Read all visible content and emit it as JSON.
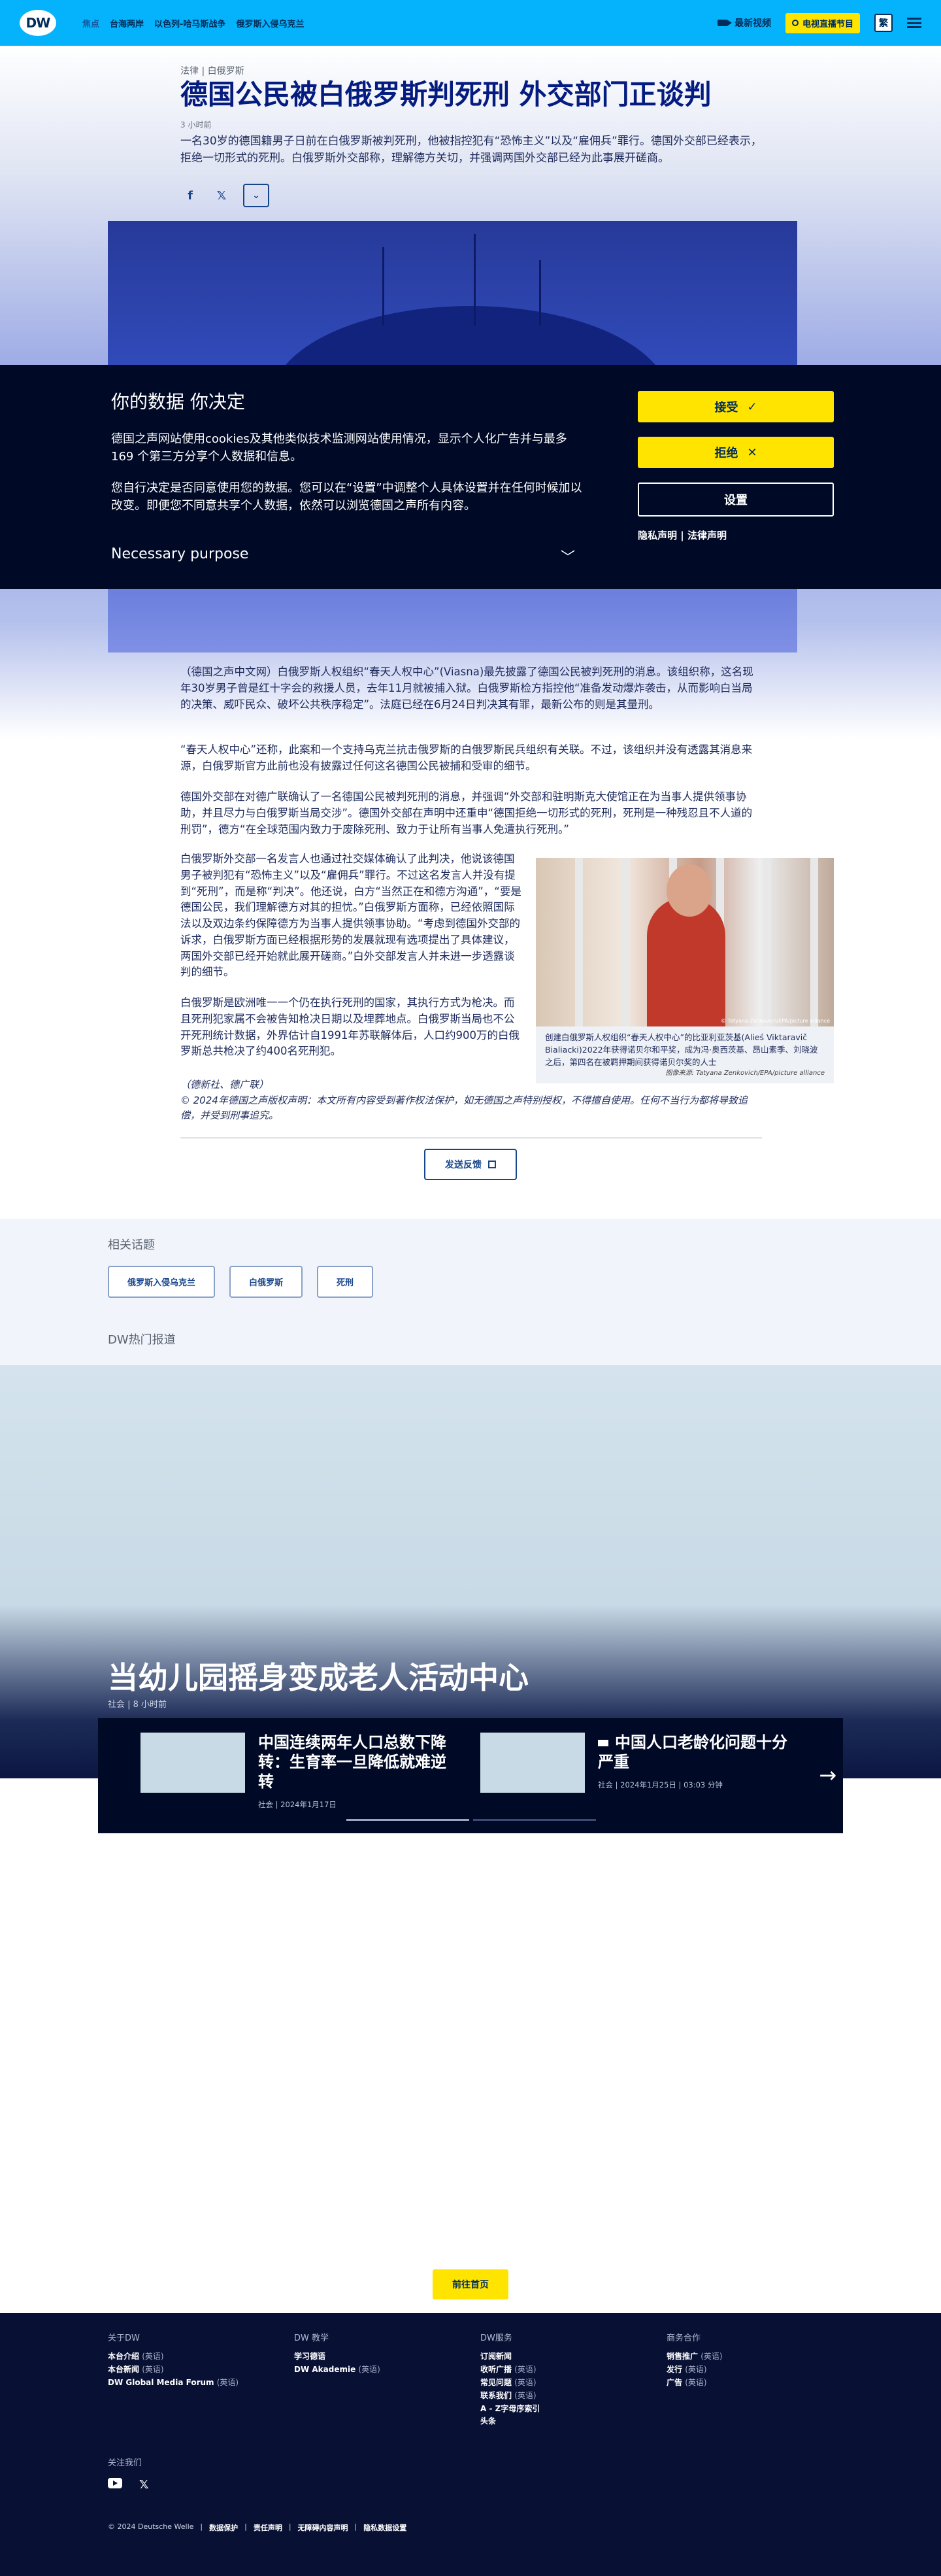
{
  "header": {
    "logo": "DW",
    "nav": [
      "焦点",
      "台海两岸",
      "以色列-哈马斯战争",
      "俄罗斯入侵乌克兰"
    ],
    "video_label": "最新视频",
    "live_label": "电视直播节目",
    "lang_label": "繁"
  },
  "article": {
    "breadcrumb": "法律 | 白俄罗斯",
    "title": "德国公民被白俄罗斯判死刑 外交部门正谈判",
    "time": "3 小时前",
    "lead": "一名30岁的德国籍男子日前在白俄罗斯被判死刑，他被指控犯有“恐怖主义”以及“雇佣兵”罪行。德国外交部已经表示，拒绝一切形式的死刑。白俄罗斯外交部称，理解德方关切，并强调两国外交部已经为此事展开磋商。",
    "paragraphs": [
      "（德国之声中文网）白俄罗斯人权组织“春天人权中心”(Viasna)最先披露了德国公民被判死刑的消息。该组织称，这名现年30岁男子曾是红十字会的救援人员，去年11月就被捕入狱。白俄罗斯检方指控他“准备发动爆炸袭击，从而影响白当局的决策、威吓民众、破坏公共秩序稳定”。法庭已经在6月24日判决其有罪，最新公布的则是其量刑。",
      "“春天人权中心”还称，此案和一个支持乌克兰抗击俄罗斯的白俄罗斯民兵组织有关联。不过，该组织并没有透露其消息来源，白俄罗斯官方此前也没有披露过任何这名德国公民被捕和受审的细节。",
      "德国外交部在对德广联确认了一名德国公民被判死刑的消息，并强调“外交部和驻明斯克大使馆正在为当事人提供领事协助，并且尽力与白俄罗斯当局交涉”。德国外交部在声明中还重申“德国拒绝一切形式的死刑，死刑是一种残忍且不人道的刑罚”，德方“在全球范围内致力于废除死刑、致力于让所有当事人免遭执行死刑。”",
      "白俄罗斯外交部一名发言人也通过社交媒体确认了此判决，他说该德国男子被判犯有“恐怖主义”以及“雇佣兵”罪行。不过这名发言人并没有提到“死刑”，而是称“判决”。他还说，白方“当然正在和德方沟通”，“要是德国公民，我们理解德方对其的担忧。”白俄罗斯方面称，已经依照国际法以及双边条约保障德方为当事人提供领事协助。“考虑到德国外交部的诉求，白俄罗斯方面已经根据形势的发展就现有选项提出了具体建议，两国外交部已经开始就此展开磋商。”白外交部发言人并未进一步透露谈判的细节。",
      "白俄罗斯是欧洲唯一一个仍在执行死刑的国家，其执行方式为枪决。而且死刑犯家属不会被告知枪决日期以及埋葬地点。白俄罗斯当局也不公开死刑统计数据，外界估计自1991年苏联解体后，人口约900万的白俄罗斯总共枪决了约400名死刑犯。"
    ],
    "agency": "（德新社、德广联）",
    "copyright": "© 2024年德国之声版权声明：本文所有内容受到著作权法保护，如无德国之声特别授权，不得擅自使用。任何不当行为都将导致追偿，并受到刑事追究。",
    "figure_caption": "创建白俄罗斯人权组织“春天人权中心”的比亚利亚茨基(Aliеś Viktaravič Bialiacki)2022年获得诺贝尔和平奖，成为冯·奥西茨基、昂山素季、刘晓波之后，第四名在被羁押期间获得诺贝尔奖的人士",
    "figure_source": "图像来源: Tatyana Zenkovich/EPA/picture alliance",
    "figure_credit": "© Tatyana Zenkovich/EPA/picture alliance",
    "feedback_label": "发送反馈"
  },
  "cookie": {
    "title": "你的数据 你决定",
    "p1": "德国之声网站使用cookies及其他类似技术监测网站使用情况，显示个人化广告并与最多169 个第三方分享个人数据和信息。",
    "p2": "您自行决定是否同意使用您的数据。您可以在“设置”中调整个人具体设置并在任何时候加以改变。即便您不同意共享个人数据，依然可以浏览德国之声所有内容。",
    "purpose": "Necessary purpose",
    "accept": "接受",
    "reject": "拒绝",
    "settings": "设置",
    "privacy": "隐私声明",
    "legal": "法律声明"
  },
  "related": {
    "title": "相关话题",
    "tags": [
      "俄罗斯入侵乌克兰",
      "白俄罗斯",
      "死刑"
    ]
  },
  "hot": {
    "title": "DW热门报道",
    "main_title": "当幼儿园摇身变成老人活动中心",
    "main_meta": "社会 | 8 小时前",
    "cards": [
      {
        "title": "中国连续两年人口总数下降转：生育率一旦降低就难逆转",
        "meta": "社会 | 2024年1月17日"
      },
      {
        "title": "中国人口老龄化问题十分严重",
        "meta": "社会 | 2024年1月25日 | 03:03 分钟"
      }
    ],
    "home_label": "前往首页"
  },
  "footer": {
    "cols": [
      {
        "title": "关于DW",
        "items": [
          {
            "t": "本台介绍",
            "s": "(英语)"
          },
          {
            "t": "本台新闻",
            "s": "(英语)"
          },
          {
            "t": "DW Global Media Forum",
            "s": "(英语)"
          }
        ]
      },
      {
        "title": "DW 教学",
        "items": [
          {
            "t": "学习德语",
            "s": ""
          },
          {
            "t": "DW Akademie",
            "s": "(英语)"
          }
        ]
      },
      {
        "title": "DW服务",
        "items": [
          {
            "t": "订阅新闻",
            "s": ""
          },
          {
            "t": "收听广播",
            "s": "(英语)"
          },
          {
            "t": "常见问题",
            "s": "(英语)"
          },
          {
            "t": "联系我们",
            "s": "(英语)"
          },
          {
            "t": "A - Z字母序索引",
            "s": ""
          },
          {
            "t": "头条",
            "s": ""
          }
        ]
      },
      {
        "title": "商务合作",
        "items": [
          {
            "t": "销售推广",
            "s": "(英语)"
          },
          {
            "t": "发行",
            "s": "(英语)"
          },
          {
            "t": "广告",
            "s": "(英语)"
          }
        ]
      }
    ],
    "follow": "关注我们",
    "legal": [
      "© 2024 Deutsche Welle",
      "数据保护",
      "责任声明",
      "无障碍内容声明",
      "隐私数据设置"
    ]
  }
}
